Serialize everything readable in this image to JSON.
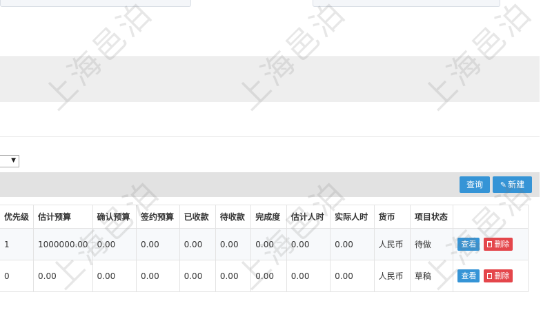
{
  "toolbar": {
    "query_label": "查询",
    "new_label": "新建",
    "new_icon": "pencil-icon"
  },
  "filter": {
    "select_arrow": "▼"
  },
  "table": {
    "headers": [
      "优先级",
      "估计预算",
      "确认预算",
      "签约预算",
      "已收款",
      "待收款",
      "完成度",
      "估计人时",
      "实际人时",
      "货币",
      "项目状态",
      ""
    ],
    "rows": [
      {
        "cells": [
          "1",
          "1000000.00",
          "0.00",
          "0.00",
          "0.00",
          "0.00",
          "0.00",
          "0.00",
          "0.00",
          "人民币",
          "待做"
        ],
        "view_label": "查看",
        "delete_label": "删除"
      },
      {
        "cells": [
          "0",
          "0.00",
          "0.00",
          "0.00",
          "0.00",
          "0.00",
          "0.00",
          "0.00",
          "0.00",
          "人民币",
          "草稿"
        ],
        "view_label": "查看",
        "delete_label": "删除"
      }
    ]
  },
  "watermark": {
    "text": "上海邑泊"
  },
  "colors": {
    "primary_button": "#3594d6",
    "danger_button": "#e4464b",
    "toolbar_bg": "#e2e2e2",
    "band_bg": "#eeeeee"
  }
}
